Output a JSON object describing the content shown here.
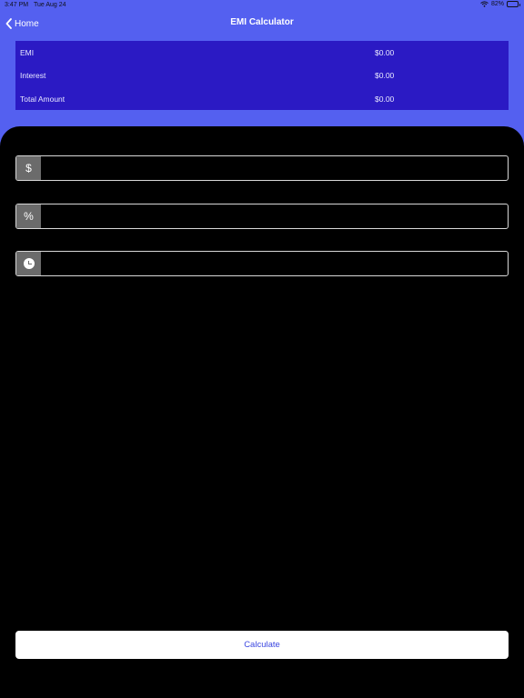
{
  "status_bar": {
    "time": "3:47 PM",
    "date": "Tue Aug 24",
    "battery_percent": "82%",
    "battery_level": 0.82,
    "wifi_icon": "wifi-icon",
    "battery_icon": "battery-icon"
  },
  "nav": {
    "back_label": "Home",
    "back_icon": "chevron-left-icon",
    "title": "EMI Calculator"
  },
  "summary": {
    "rows": [
      {
        "label": "EMI",
        "value": "$0.00"
      },
      {
        "label": "Interest",
        "value": "$0.00"
      },
      {
        "label": "Total Amount",
        "value": "$0.00"
      }
    ]
  },
  "form": {
    "amount": {
      "prefix": "$",
      "value": "",
      "placeholder": ""
    },
    "rate": {
      "prefix": "%",
      "value": "",
      "placeholder": ""
    },
    "tenure": {
      "prefix_icon": "clock-icon",
      "value": "",
      "placeholder": ""
    },
    "calculate_label": "Calculate"
  },
  "colors": {
    "header_bg": "#5460f0",
    "summary_bg": "#2b1ac4",
    "sheet_bg": "#000000",
    "accent_text": "#3b47e0"
  }
}
